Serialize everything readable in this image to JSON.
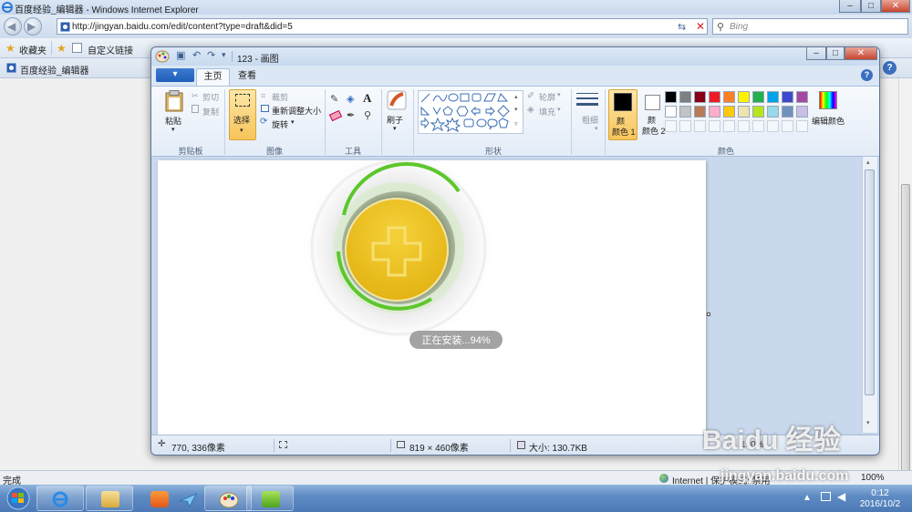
{
  "ie": {
    "title": "百度经验_编辑器 - Windows Internet Explorer",
    "url": "http://jingyan.baidu.com/edit/content?type=draft&did=5",
    "search_placeholder": "Bing",
    "favorites_label": "收藏夹",
    "custom_links_label": "自定义链接",
    "tab_title": "百度经验_编辑器",
    "status_text": "完成",
    "zone_text": "Internet | 保护模式: 禁用",
    "zoom_text": "100%"
  },
  "paint": {
    "title": "123 - 画图",
    "app_menu": "▾",
    "tabs": [
      "主页",
      "查看"
    ],
    "clipboard": {
      "paste": "粘贴",
      "cut": "剪切",
      "copy": "复制",
      "group": "剪贴板"
    },
    "image": {
      "select": "选择",
      "crop": "裁剪",
      "resize": "重新调整大小",
      "rotate": "旋转",
      "group": "图像"
    },
    "tools": {
      "group": "工具"
    },
    "brushes": {
      "label": "刷子"
    },
    "shapes": {
      "outline": "轮廓",
      "fill": "填充",
      "group": "形状"
    },
    "size": {
      "label": "粗细"
    },
    "colors": {
      "color1": "颜色 1",
      "color2": "颜色 2",
      "edit": "编辑颜色",
      "group": "颜色",
      "color1_value": "#000000",
      "color2_value": "#ffffff",
      "palette_row1": [
        "#000000",
        "#7f7f7f",
        "#880015",
        "#ed1c24",
        "#ff7f27",
        "#fff200",
        "#22b14c",
        "#00a2e8",
        "#3f48cc",
        "#a349a4"
      ],
      "palette_row2": [
        "#ffffff",
        "#c3c3c3",
        "#b97a57",
        "#ffaec9",
        "#ffc90e",
        "#efe4b0",
        "#b5e61d",
        "#99d9ea",
        "#7092be",
        "#c8bfe7"
      ]
    },
    "install_text": "正在安装...94%",
    "install_progress_pct": 94,
    "status": {
      "cursor": "770, 336像素",
      "dims": "819 × 460像素",
      "size": "大小: 130.7KB",
      "zoom": "100%"
    }
  },
  "taskbar": {
    "time": "0:12",
    "date": "2016/10/2"
  },
  "watermark": {
    "logo": "Baidu 经验",
    "site": "jingyan.baidu.com"
  }
}
